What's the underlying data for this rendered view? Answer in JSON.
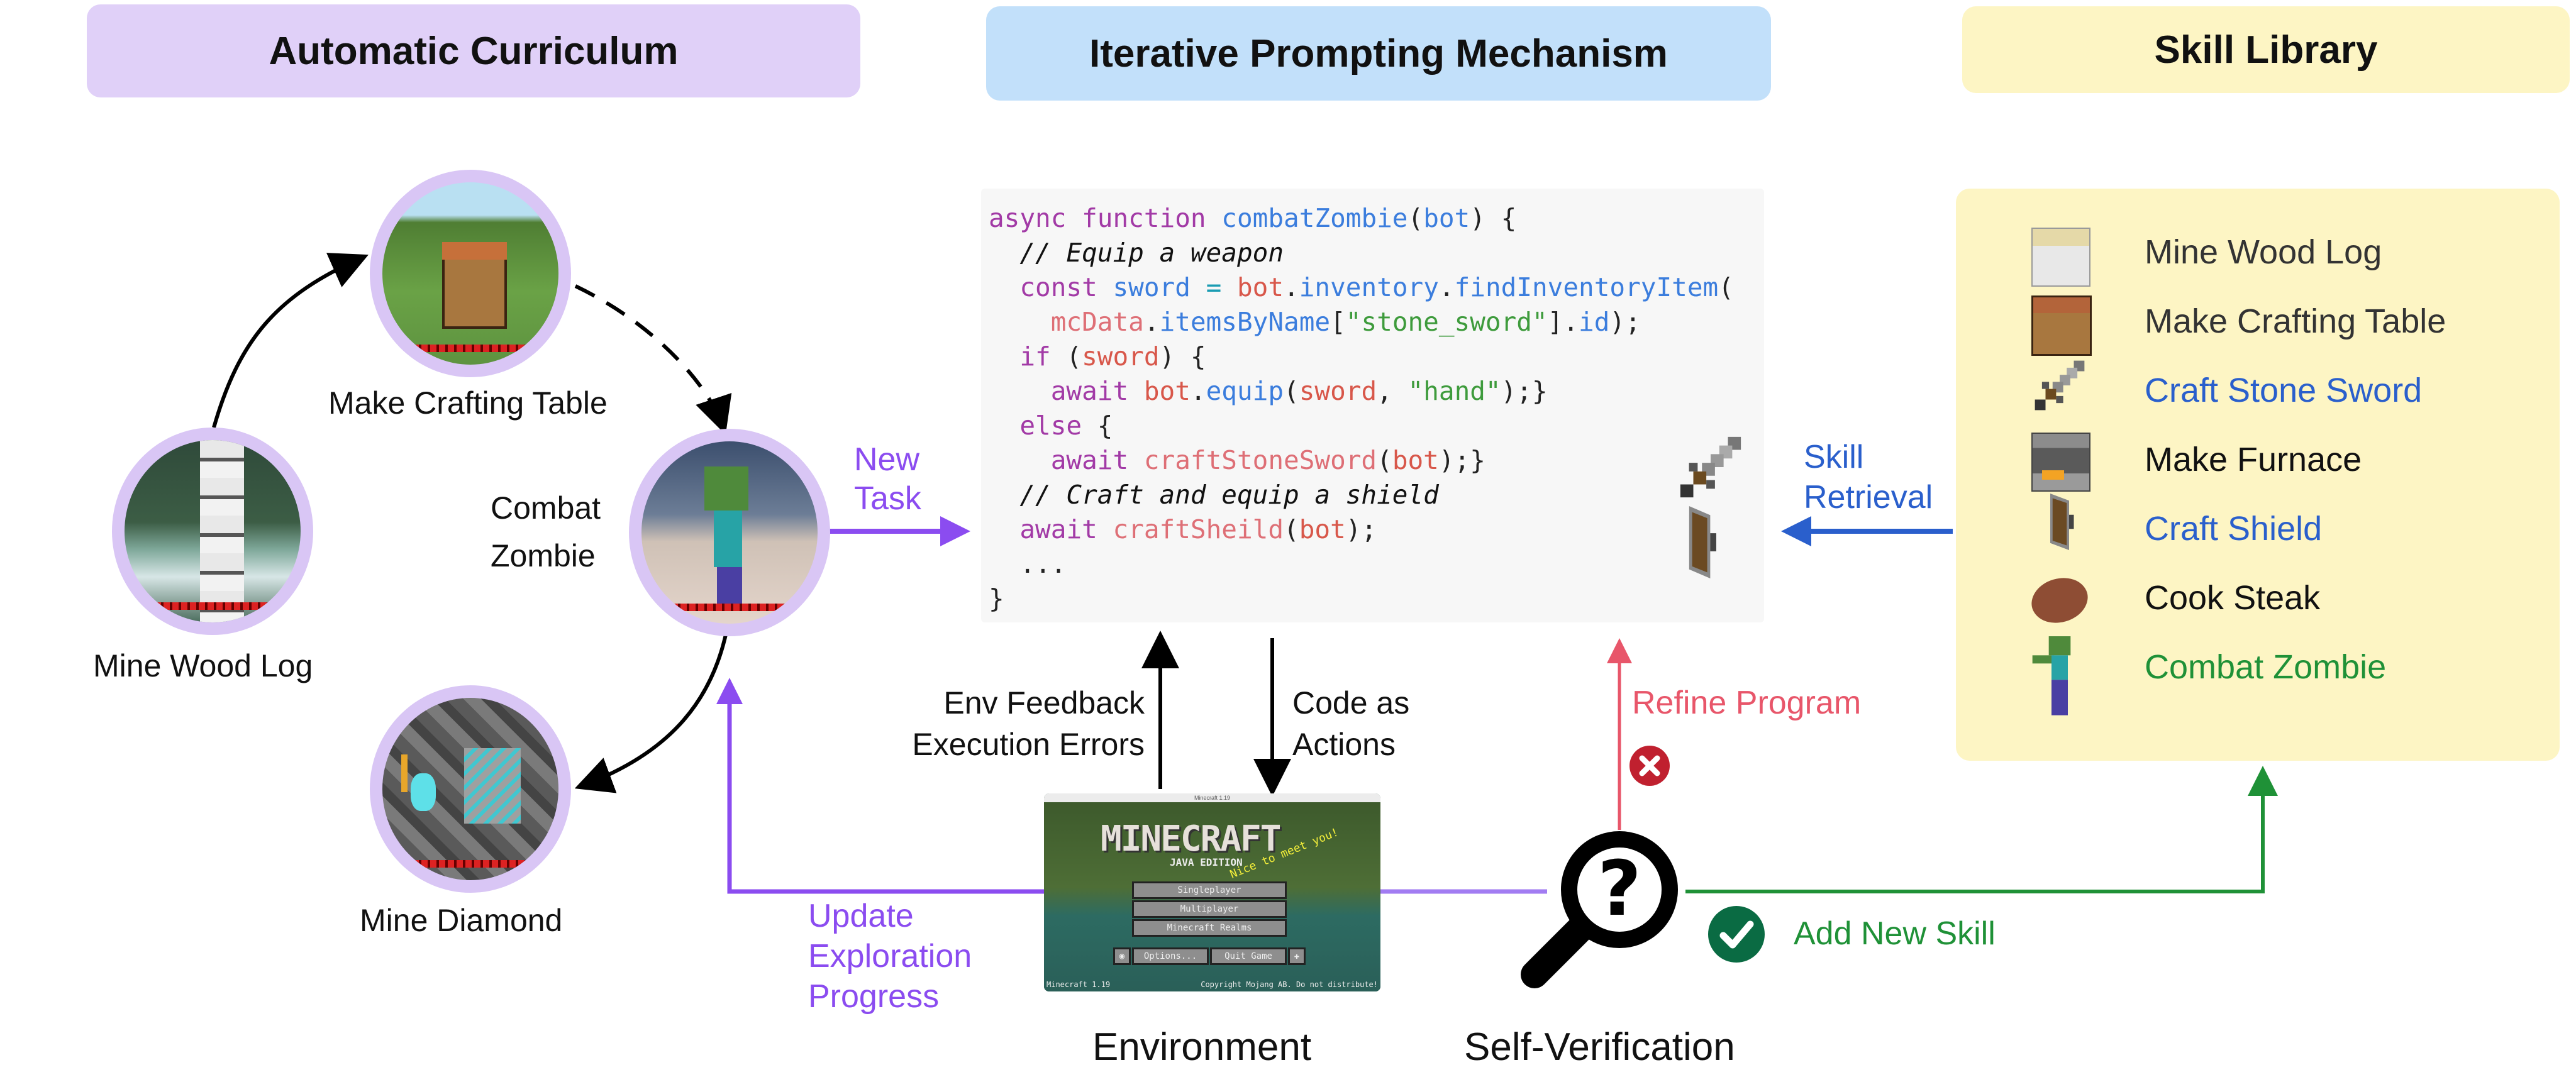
{
  "headers": {
    "curriculum": "Automatic Curriculum",
    "prompting": "Iterative Prompting Mechanism",
    "library": "Skill Library"
  },
  "curriculum": {
    "nodes": [
      {
        "label": "Mine Wood Log",
        "scene": "birch-tree-scene"
      },
      {
        "label": "Make Crafting Table",
        "scene": "crafting-table-scene"
      },
      {
        "label_line1": "Combat",
        "label_line2": "Zombie",
        "scene": "zombie-scene"
      },
      {
        "label": "Mine Diamond",
        "scene": "diamond-scene"
      }
    ]
  },
  "arrows": {
    "new_task_line1": "New",
    "new_task_line2": "Task",
    "skill_retrieval_line1": "Skill",
    "skill_retrieval_line2": "Retrieval",
    "env_feedback_line1": "Env Feedback",
    "env_feedback_line2": "Execution Errors",
    "code_actions_line1": "Code as",
    "code_actions_line2": "Actions",
    "refine_program": "Refine Program",
    "add_new_skill": "Add New Skill",
    "update_line1": "Update",
    "update_line2": "Exploration",
    "update_line3": "Progress"
  },
  "code": {
    "l1_kw1": "async",
    "l1_kw2": "function",
    "l1_fn": "combatZombie",
    "l1_arg": "bot",
    "l2_comment": "// Equip a weapon",
    "l3_kw": "const",
    "l3_var": "sword",
    "l3_obj": "bot",
    "l3_prop": "inventory",
    "l3_fn": "findInventoryItem",
    "l4_obj": "mcData",
    "l4_prop": "itemsByName",
    "l4_str": "\"stone_sword\"",
    "l4_id": "id",
    "l5_kw": "if",
    "l5_var": "sword",
    "l6_kw": "await",
    "l6_obj": "bot",
    "l6_fn": "equip",
    "l6_var": "sword",
    "l6_str": "\"hand\"",
    "l7_kw": "else",
    "l8_kw": "await",
    "l8_fn": "craftStoneSword",
    "l8_arg": "bot",
    "l9_comment": "// Craft and equip a shield",
    "l10_kw": "await",
    "l10_fn": "craftSheild",
    "l10_arg": "bot",
    "l11": "...",
    "l12": "}"
  },
  "skill_library": {
    "items": [
      {
        "label": "Mine Wood  Log",
        "icon": "birch-log-icon",
        "color": "#333333"
      },
      {
        "label": "Make Crafting Table",
        "icon": "crafting-table-icon",
        "color": "#333333"
      },
      {
        "label": "Craft Stone Sword",
        "icon": "stone-sword-icon",
        "color": "#2a5fcc"
      },
      {
        "label": "Make Furnace",
        "icon": "furnace-icon",
        "color": "#111111"
      },
      {
        "label": "Craft Shield",
        "icon": "shield-icon",
        "color": "#2a5fcc"
      },
      {
        "label": "Cook Steak",
        "icon": "steak-icon",
        "color": "#111111"
      },
      {
        "label": "Combat Zombie",
        "icon": "zombie-icon",
        "color": "#1f9137"
      }
    ]
  },
  "environment": {
    "label": "Environment",
    "window_title": "Minecraft 1.19",
    "logo": "MINECRAFT",
    "edition": "JAVA EDITION",
    "splash": "Nice to meet you!",
    "buttons": [
      "Singleplayer",
      "Multiplayer",
      "Minecraft Realms",
      "Options...",
      "Quit Game"
    ],
    "version": "Minecraft 1.19",
    "copyright": "Copyright Mojang AB. Do not distribute!"
  },
  "verification": {
    "label": "Self-Verification"
  },
  "colors": {
    "purple": "#8b4cf0",
    "blue": "#2a5fcc",
    "red": "#e8566a",
    "green": "#1f9137",
    "dark_red": "#c0202f",
    "dark_green": "#0a6b43"
  }
}
